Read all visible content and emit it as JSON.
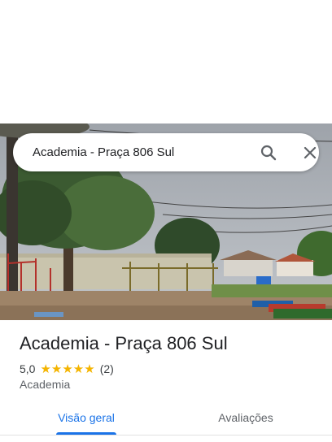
{
  "search": {
    "query": "Academia - Praça 806 Sul",
    "search_icon": "search-icon",
    "close_icon": "close-icon"
  },
  "place": {
    "title": "Academia - Praça 806 Sul",
    "rating": "5,0",
    "stars": "★★★★★",
    "review_count": "(2)",
    "category": "Academia"
  },
  "tabs": [
    {
      "label": "Visão geral",
      "selected": true
    },
    {
      "label": "Avaliações",
      "selected": false
    }
  ],
  "colors": {
    "accent": "#1a73e8",
    "star": "#f4b400",
    "text_primary": "#202124",
    "text_secondary": "#5f6368"
  }
}
